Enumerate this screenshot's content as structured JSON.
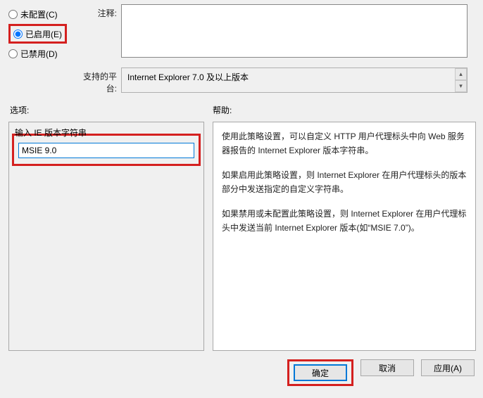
{
  "radios": {
    "not_configured": "未配置(C)",
    "enabled": "已启用(E)",
    "disabled": "已禁用(D)",
    "selected": "enabled"
  },
  "labels": {
    "comment": "注释:",
    "platform": "支持的平台:",
    "options": "选项:",
    "help": "帮助:",
    "input_version": "输入 IE 版本字符串"
  },
  "fields": {
    "comment_value": "",
    "platform_value": "Internet Explorer 7.0 及以上版本",
    "version_input": "MSIE 9.0"
  },
  "help_text": {
    "p1": "使用此策略设置，可以自定义 HTTP 用户代理标头中向 Web 服务器报告的 Internet Explorer 版本字符串。",
    "p2": "如果启用此策略设置，则 Internet Explorer 在用户代理标头的版本部分中发送指定的自定义字符串。",
    "p3": "如果禁用或未配置此策略设置，则 Internet Explorer 在用户代理标头中发送当前 Internet Explorer 版本(如“MSIE 7.0”)。"
  },
  "buttons": {
    "ok": "确定",
    "cancel": "取消",
    "apply": "应用(A)"
  }
}
